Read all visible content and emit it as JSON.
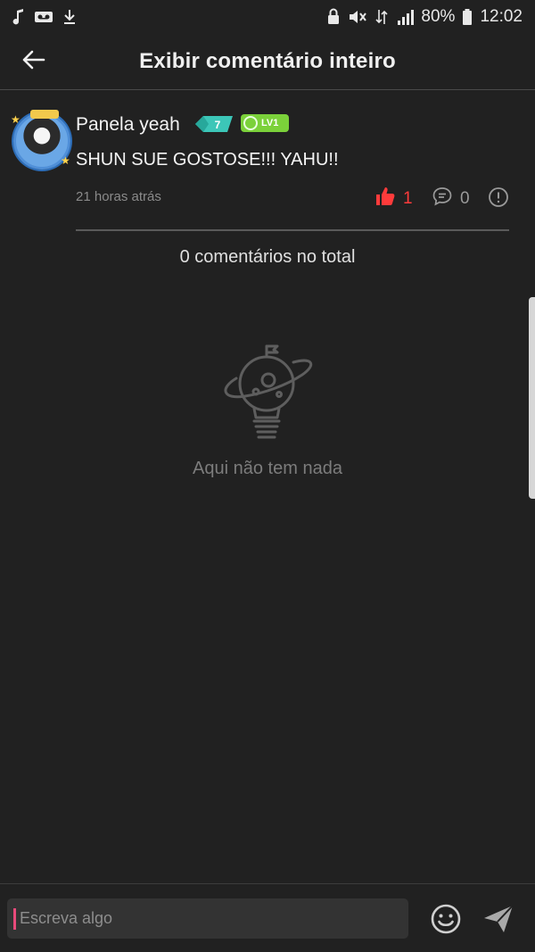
{
  "status_bar": {
    "battery": "80%",
    "time": "12:02",
    "icons": [
      "music-note-icon",
      "voicemail-icon",
      "download-icon",
      "lock-icon",
      "mute-icon",
      "data-arrows-icon",
      "signal-icon",
      "battery-icon"
    ]
  },
  "header": {
    "title": "Exibir comentário inteiro",
    "back_icon": "arrow-left-icon"
  },
  "comment": {
    "username": "Panela yeah",
    "rank_badge": "7",
    "level_badge": "LV1",
    "text": "SHUN SUE GOSTOSE!!! YAHU!!",
    "time_ago": "21 horas atrás",
    "likes": "1",
    "replies": "0"
  },
  "total_label": "0 comentários no total",
  "empty_state": {
    "text": "Aqui não tem nada",
    "icon": "planet-lightbulb-icon"
  },
  "composer": {
    "placeholder": "Escreva algo",
    "value": ""
  },
  "colors": {
    "background": "#212121",
    "like": "#ff3b3b",
    "cursor": "#e84a7a",
    "level_badge": "#7bd13a",
    "rank_badge": "#3cc6b8"
  }
}
